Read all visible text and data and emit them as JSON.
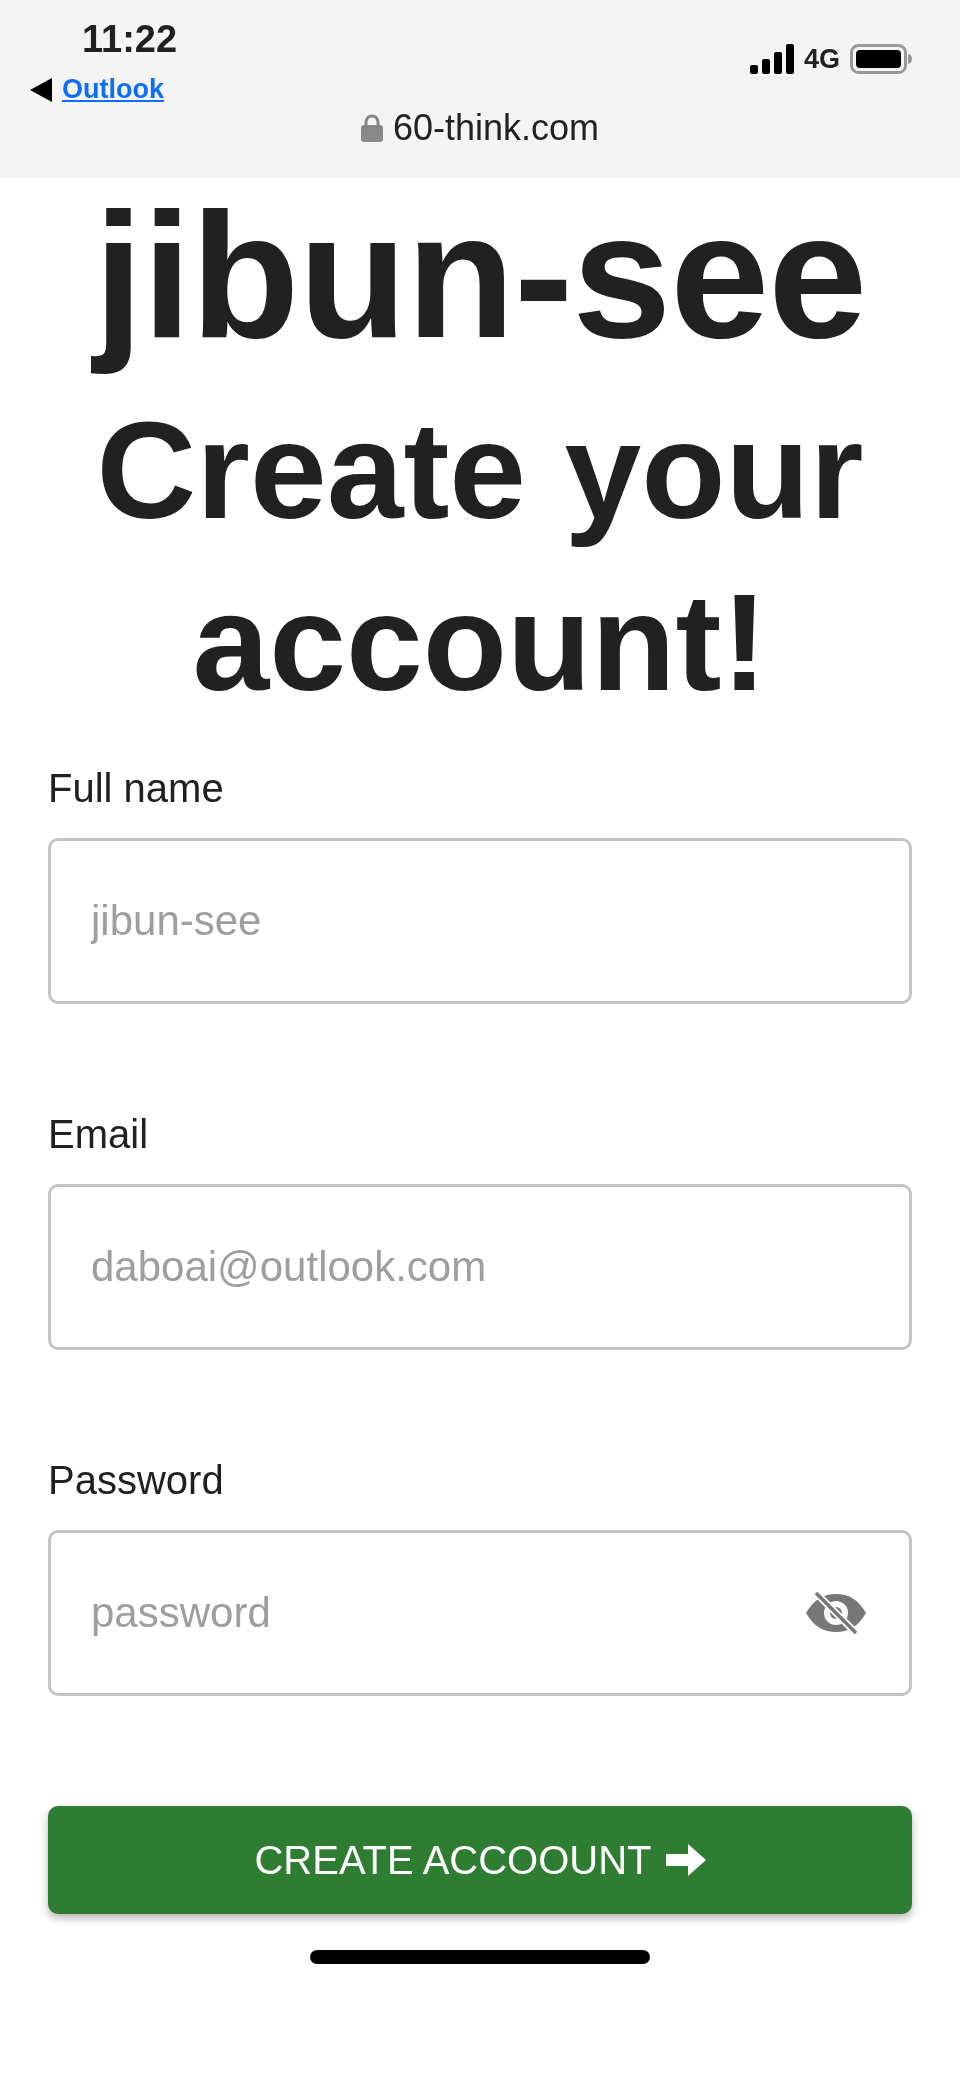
{
  "status_bar": {
    "time": "11:22",
    "back_label": "Outlook",
    "network": "4G",
    "url": "60-think.com"
  },
  "brand": "jibun-see",
  "heading": "Create your account!",
  "fields": [
    {
      "label": "Full name",
      "placeholder": "jibun-see",
      "kind": "text"
    },
    {
      "label": "Email",
      "placeholder": "daboai@outlook.com",
      "kind": "email"
    },
    {
      "label": "Password",
      "placeholder": "password",
      "kind": "password",
      "password_visible": false
    }
  ],
  "submit_button": {
    "label": "CREATE ACCOOUNT"
  }
}
